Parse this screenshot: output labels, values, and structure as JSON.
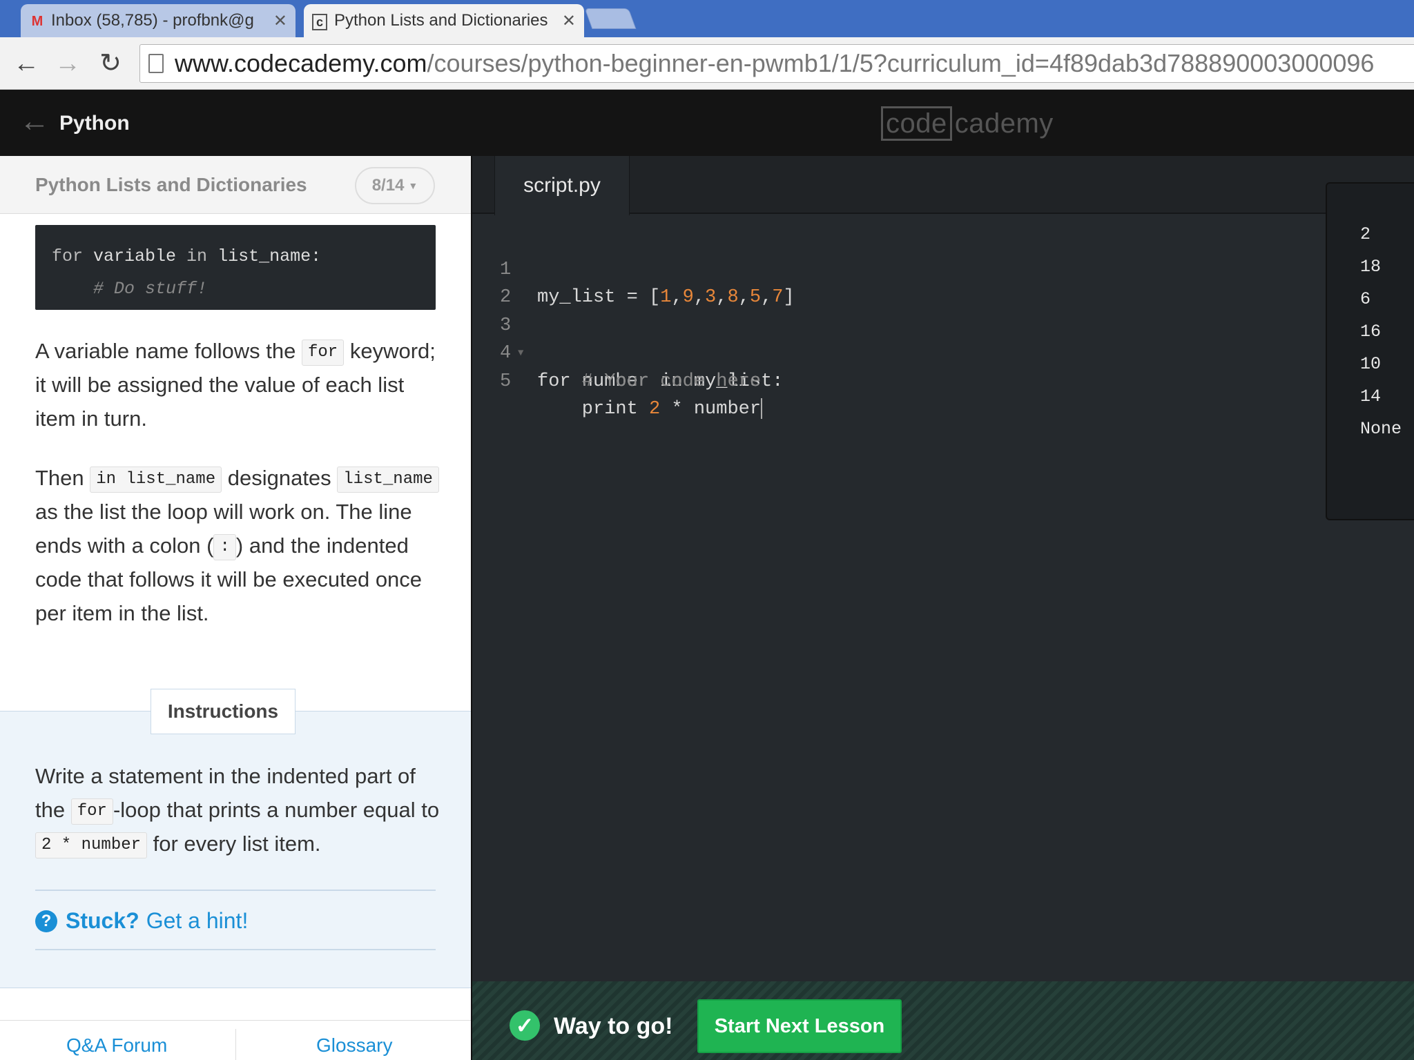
{
  "browser": {
    "tabs": [
      {
        "title": "Inbox (58,785) - profbnk@g",
        "favicon": "M",
        "favicon_icon": "gmail-icon",
        "active": false
      },
      {
        "title": "Python Lists and Dictionaries",
        "favicon": "c",
        "favicon_icon": "codecademy-icon",
        "active": true
      }
    ],
    "url_host": "www.codecademy.com",
    "url_path": "/courses/python-beginner-en-pwmb1/1/5?curriculum_id=4f89dab3d788890003000096"
  },
  "header": {
    "course_title": "Python",
    "logo_part1": "code",
    "logo_part2": "cademy"
  },
  "lesson": {
    "title": "Python Lists and Dictionaries",
    "progress": "8/14"
  },
  "code_sample": {
    "line1_kw": "for",
    "line1_a": " variable ",
    "line1_kw2": "in",
    "line1_b": " list_name:",
    "line2": "    # Do stuff!"
  },
  "body": {
    "p1_a": "A variable name follows the ",
    "p1_code": "for",
    "p1_b": " keyword; it will be assigned the value of each list item in turn.",
    "p2_a": "Then ",
    "p2_code1": "in list_name",
    "p2_b": " designates ",
    "p2_code2": "list_name",
    "p2_c": " as the list the loop will work on. The line ends with a colon (",
    "p2_code3": ":",
    "p2_d": ") and the indented code that follows it will be executed once per item in the list."
  },
  "instructions": {
    "tab_label": "Instructions",
    "text_a": "Write a statement in the indented part of the ",
    "text_code1": "for",
    "text_b": "-loop that prints a number equal to ",
    "text_code2": "2 * number",
    "text_c": " for every list item.",
    "hint_prefix": "Stuck?",
    "hint_link": "Get a hint!"
  },
  "footer": {
    "qa_label": "Q&A Forum",
    "glossary_label": "Glossary"
  },
  "editor": {
    "filename": "script.py",
    "line_numbers": [
      "1",
      "2",
      "3",
      "4",
      "5"
    ],
    "l1_a": "my_list = [",
    "l1_nums": [
      "1",
      "9",
      "3",
      "8",
      "5",
      "7"
    ],
    "l1_b": "]",
    "l3": "for number in my_list:",
    "l4": "    # Your code here",
    "l5_a": "    print ",
    "l5_num": "2",
    "l5_b": " * number"
  },
  "output": {
    "lines": [
      "2",
      "18",
      "6",
      "16",
      "10",
      "14",
      "None"
    ]
  },
  "success": {
    "message": "Way to go!",
    "button_label": "Start Next Lesson"
  },
  "colors": {
    "accent_blue": "#1a8fd6",
    "success_green": "#1fb452",
    "editor_bg": "#25292d",
    "number_orange": "#e8873a"
  }
}
